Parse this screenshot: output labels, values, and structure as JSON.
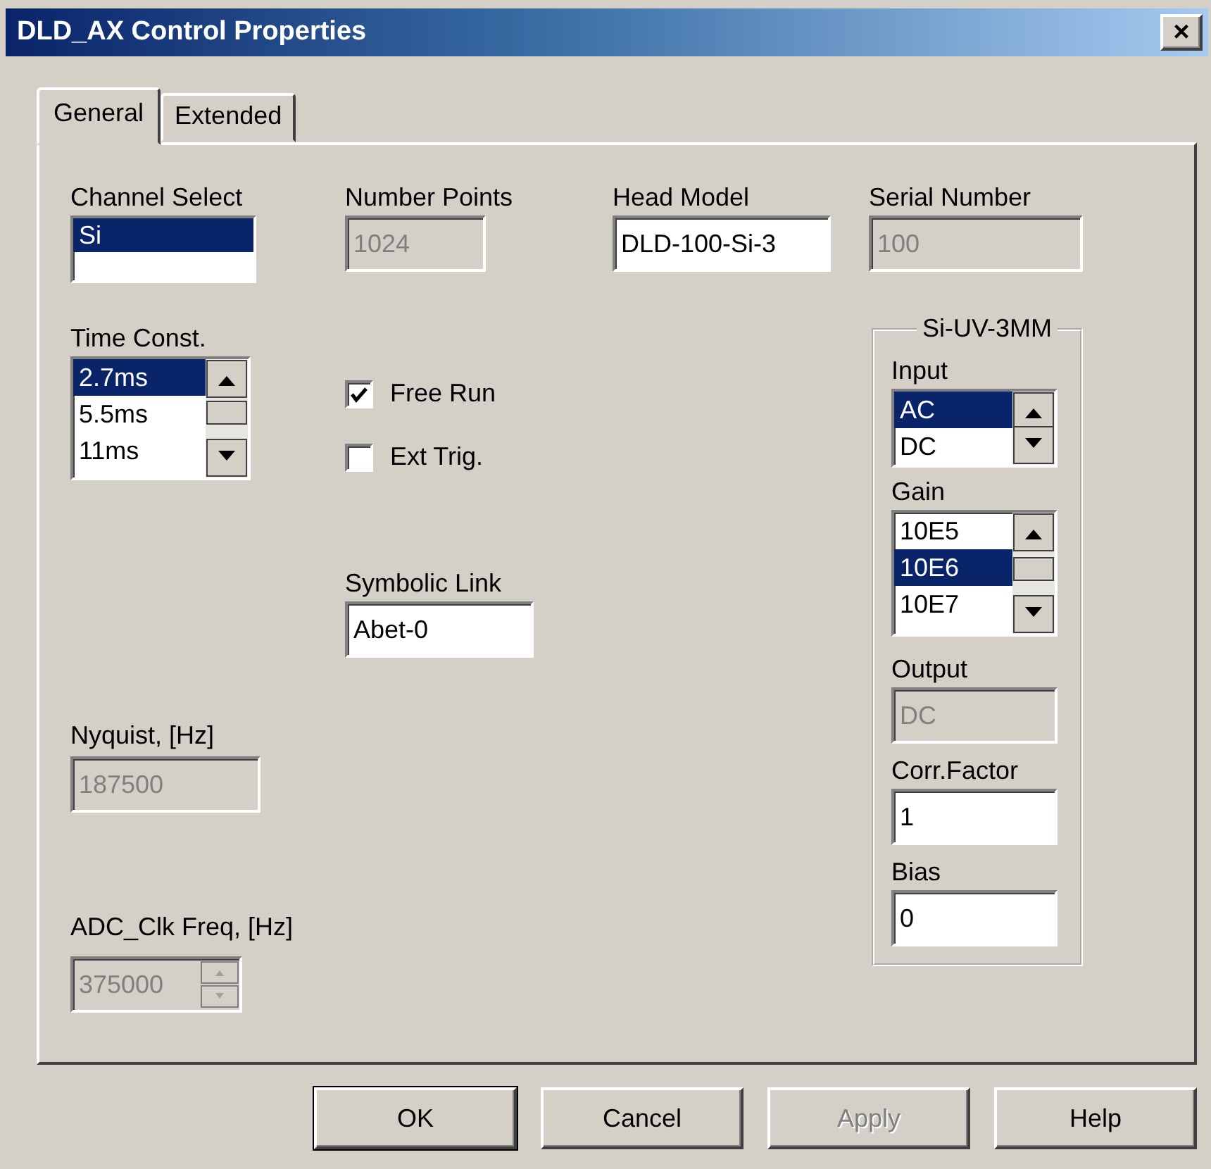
{
  "window": {
    "title": "DLD_AX Control Properties",
    "close": "×"
  },
  "tabs": [
    {
      "label": "General",
      "selected": true
    },
    {
      "label": "Extended",
      "selected": false
    }
  ],
  "channel_select": {
    "label": "Channel Select",
    "items": [
      {
        "text": "Si",
        "selected": true
      }
    ]
  },
  "number_points": {
    "label": "Number Points",
    "value": "1024",
    "disabled": true
  },
  "head_model": {
    "label": "Head Model",
    "value": "DLD-100-Si-3",
    "disabled": false
  },
  "serial_number": {
    "label": "Serial Number",
    "value": "100",
    "disabled": true
  },
  "time_const": {
    "label": "Time Const.",
    "items": [
      {
        "text": "2.7ms",
        "selected": true
      },
      {
        "text": "5.5ms",
        "selected": false
      },
      {
        "text": "11ms",
        "selected": false
      }
    ]
  },
  "checkboxes": [
    {
      "label": "Free Run",
      "checked": true
    },
    {
      "label": "Ext Trig.",
      "checked": false
    }
  ],
  "symbolic_link": {
    "label": "Symbolic Link",
    "value": "Abet-0",
    "disabled": false
  },
  "nyquist": {
    "label": "Nyquist, [Hz]",
    "value": "187500",
    "disabled": true
  },
  "adc_clk": {
    "label": "ADC_Clk Freq, [Hz]",
    "value": "375000",
    "disabled": true
  },
  "group": {
    "title": "Si-UV-3MM",
    "input": {
      "label": "Input",
      "items": [
        {
          "text": "AC",
          "selected": true
        },
        {
          "text": "DC",
          "selected": false
        }
      ]
    },
    "gain": {
      "label": "Gain",
      "items": [
        {
          "text": "10E5",
          "selected": false
        },
        {
          "text": "10E6",
          "selected": true
        },
        {
          "text": "10E7",
          "selected": false
        }
      ]
    },
    "output": {
      "label": "Output",
      "value": "DC",
      "disabled": true
    },
    "corr_factor": {
      "label": "Corr.Factor",
      "value": "1",
      "disabled": false
    },
    "bias": {
      "label": "Bias",
      "value": "0",
      "disabled": false
    }
  },
  "buttons": [
    {
      "label": "OK",
      "disabled": false,
      "default": true
    },
    {
      "label": "Cancel",
      "disabled": false,
      "default": false
    },
    {
      "label": "Apply",
      "disabled": true,
      "default": false
    },
    {
      "label": "Help",
      "disabled": false,
      "default": false
    }
  ]
}
